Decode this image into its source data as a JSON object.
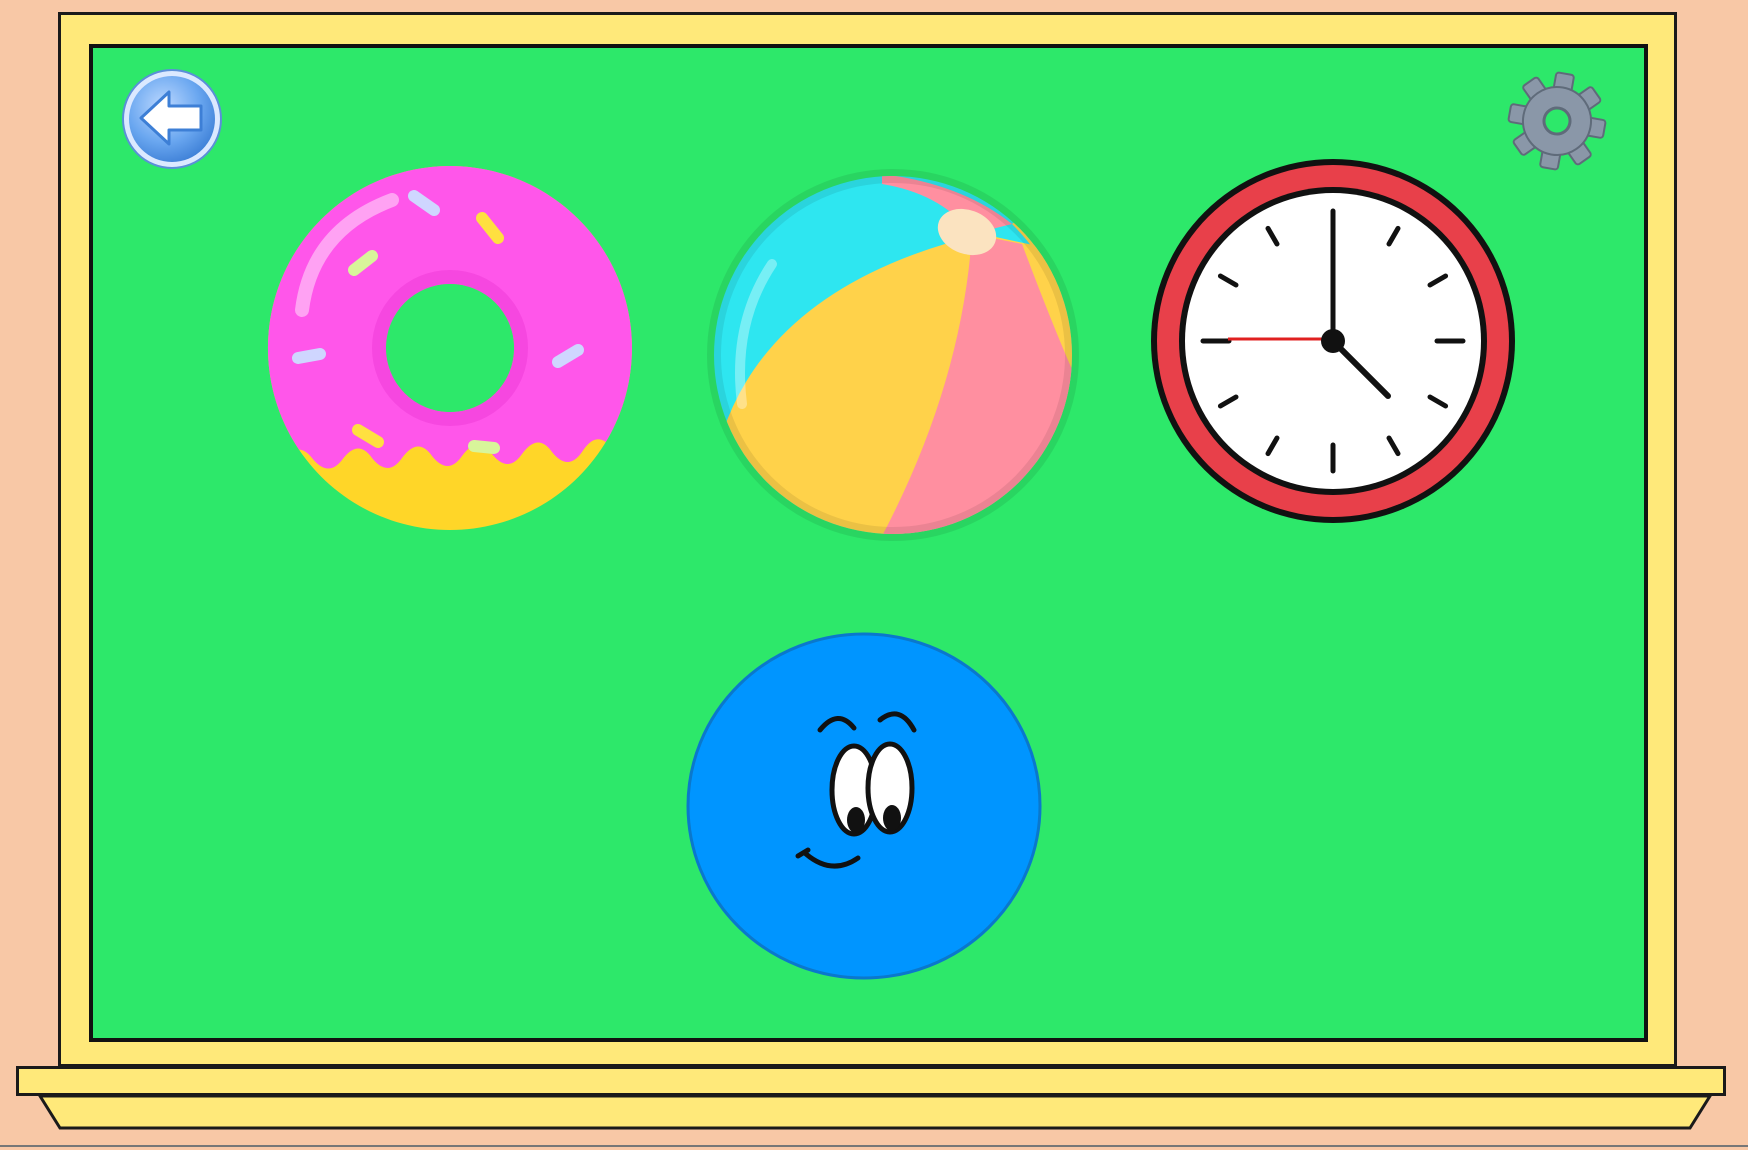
{
  "scene": {
    "colors": {
      "wall": "#f8c8a6",
      "frame": "#ffe97a",
      "board": "#2de86a",
      "outline": "#111111"
    }
  },
  "controls": {
    "back": {
      "icon": "back-arrow-icon",
      "color": "#6aa7f0"
    },
    "settings": {
      "icon": "gear-icon",
      "color": "#8a97a8"
    }
  },
  "choices": [
    {
      "object": "donut",
      "colors": {
        "icing": "#ff56ea",
        "base": "#ffd628"
      }
    },
    {
      "object": "beach-ball",
      "colors": {
        "cyan": "#2ee6f0",
        "yellow": "#ffd24a",
        "pink": "#ff8fa0",
        "cap": "#fbe3c0"
      }
    },
    {
      "object": "clock",
      "time": "4:00",
      "colors": {
        "rim": "#e8404a",
        "face": "#ffffff",
        "second-hand": "#e02020"
      }
    }
  ],
  "target": {
    "shape": "circle",
    "character": "smiling-circle",
    "color": "#0095ff"
  }
}
